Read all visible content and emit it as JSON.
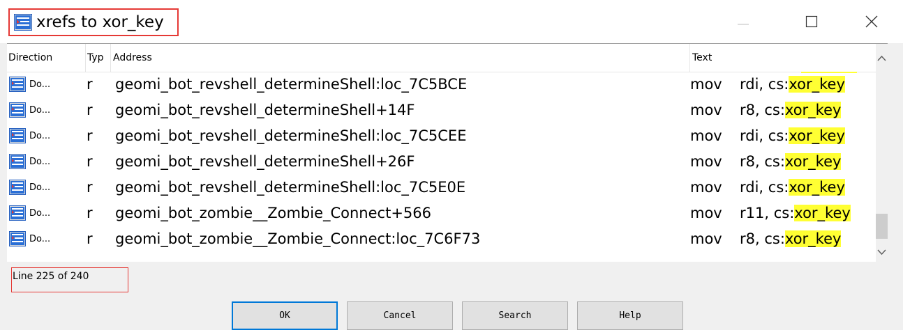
{
  "window": {
    "title": "xrefs to xor_key"
  },
  "table": {
    "columns": [
      "Direction",
      "Typ",
      "Address",
      "Text"
    ],
    "rows": [
      {
        "dir": "Do...",
        "type": "r",
        "address": "geomi_bot_revshell_determineShell:loc_7C5BCE",
        "mnemonic": "mov",
        "operand_prefix": "rdi, cs:",
        "operand_symbol": "xor_key"
      },
      {
        "dir": "Do...",
        "type": "r",
        "address": "geomi_bot_revshell_determineShell+14F",
        "mnemonic": "mov",
        "operand_prefix": "r8, cs:",
        "operand_symbol": "xor_key"
      },
      {
        "dir": "Do...",
        "type": "r",
        "address": "geomi_bot_revshell_determineShell:loc_7C5CEE",
        "mnemonic": "mov",
        "operand_prefix": "rdi, cs:",
        "operand_symbol": "xor_key"
      },
      {
        "dir": "Do...",
        "type": "r",
        "address": "geomi_bot_revshell_determineShell+26F",
        "mnemonic": "mov",
        "operand_prefix": "r8, cs:",
        "operand_symbol": "xor_key"
      },
      {
        "dir": "Do...",
        "type": "r",
        "address": "geomi_bot_revshell_determineShell:loc_7C5E0E",
        "mnemonic": "mov",
        "operand_prefix": "rdi, cs:",
        "operand_symbol": "xor_key"
      },
      {
        "dir": "Do...",
        "type": "r",
        "address": "geomi_bot_zombie__Zombie_Connect+566",
        "mnemonic": "mov",
        "operand_prefix": "r11, cs:",
        "operand_symbol": "xor_key"
      },
      {
        "dir": "Do...",
        "type": "r",
        "address": "geomi_bot_zombie__Zombie_Connect:loc_7C6F73",
        "mnemonic": "mov",
        "operand_prefix": "r8, cs:",
        "operand_symbol": "xor_key"
      }
    ]
  },
  "status": {
    "line_info": "Line 225 of 240"
  },
  "buttons": {
    "ok": "OK",
    "cancel": "Cancel",
    "search": "Search",
    "help": "Help"
  },
  "colors": {
    "highlight": "#ffff33",
    "annotation_red": "#e53935",
    "focus_blue": "#0078d7"
  }
}
